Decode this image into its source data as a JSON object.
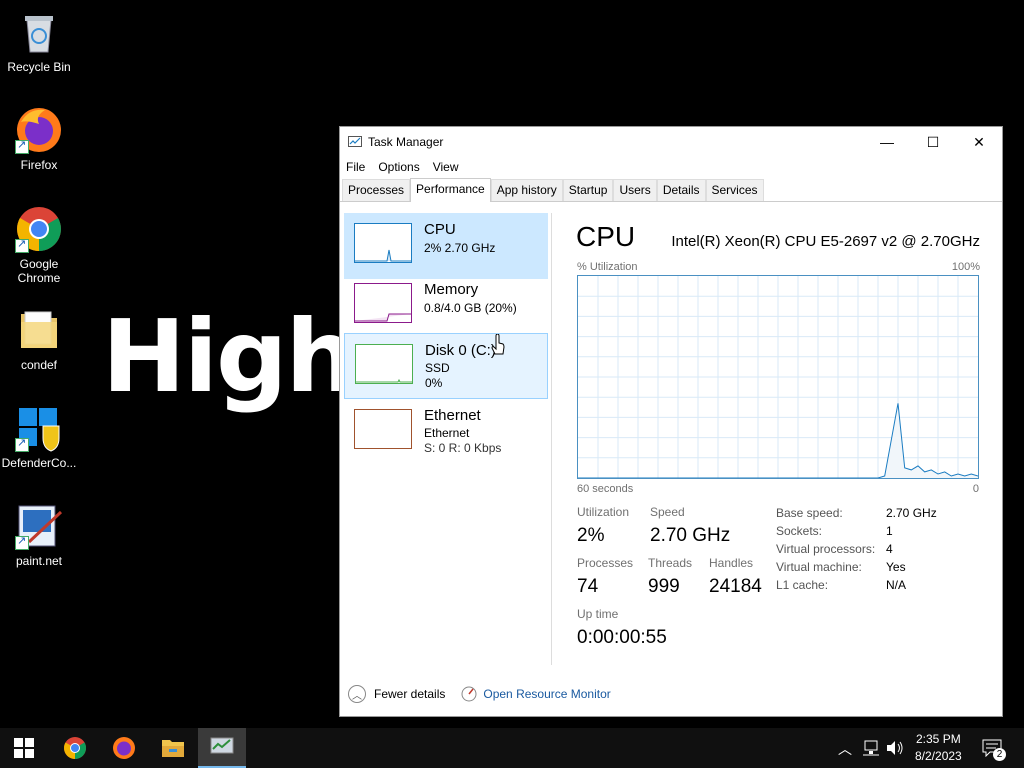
{
  "desktop": {
    "icons": [
      {
        "label": "Recycle Bin",
        "icon": "recycle-bin-icon"
      },
      {
        "label": "Firefox",
        "icon": "firefox-icon"
      },
      {
        "label": "Google Chrome",
        "icon": "chrome-icon"
      },
      {
        "label": "condef",
        "icon": "folder-icon"
      },
      {
        "label": "DefenderCo...",
        "icon": "defender-icon"
      },
      {
        "label": "paint.net",
        "icon": "paintnet-icon"
      }
    ],
    "overlay_text": "High"
  },
  "window": {
    "title": "Task Manager",
    "controls": {
      "minimize": "—",
      "maximize": "☐",
      "close": "✕"
    },
    "menu": [
      "File",
      "Options",
      "View"
    ],
    "tabs": [
      "Processes",
      "Performance",
      "App history",
      "Startup",
      "Users",
      "Details",
      "Services"
    ],
    "active_tab": "Performance"
  },
  "resources": [
    {
      "name": "CPU",
      "line1": "2%  2.70 GHz",
      "line2": "",
      "color": "#1a7cc2"
    },
    {
      "name": "Memory",
      "line1": "0.8/4.0 GB (20%)",
      "line2": "",
      "color": "#8b1a8b"
    },
    {
      "name": "Disk 0 (C:)",
      "line1": "SSD",
      "line2": "0%",
      "color": "#4caf50"
    },
    {
      "name": "Ethernet",
      "line1": "Ethernet",
      "line2": "S: 0  R: 0 Kbps",
      "color": "#a0522d"
    }
  ],
  "detail": {
    "title": "CPU",
    "model": "Intel(R) Xeon(R) CPU E5-2697 v2 @ 2.70GHz",
    "y_label": "% Utilization",
    "y_max_label": "100%",
    "x_left_label": "60 seconds",
    "x_right_label": "0",
    "stats": {
      "utilization_label": "Utilization",
      "utilization": "2%",
      "speed_label": "Speed",
      "speed": "2.70 GHz",
      "processes_label": "Processes",
      "processes": "74",
      "threads_label": "Threads",
      "threads": "999",
      "handles_label": "Handles",
      "handles": "24184",
      "uptime_label": "Up time",
      "uptime": "0:00:00:55"
    },
    "specs": [
      {
        "k": "Base speed:",
        "v": "2.70 GHz"
      },
      {
        "k": "Sockets:",
        "v": "1"
      },
      {
        "k": "Virtual processors:",
        "v": "4"
      },
      {
        "k": "Virtual machine:",
        "v": "Yes"
      },
      {
        "k": "L1 cache:",
        "v": "N/A"
      }
    ]
  },
  "chart_data": {
    "type": "area",
    "x": [
      60,
      57,
      54,
      51,
      48,
      45,
      42,
      39,
      36,
      33,
      30,
      27,
      24,
      21,
      18,
      15,
      14,
      12,
      11,
      10,
      9,
      8,
      7,
      6,
      5,
      4,
      3,
      2,
      1,
      0
    ],
    "y": [
      0,
      0,
      0,
      0,
      0,
      0,
      0,
      0,
      0,
      0,
      0,
      0,
      0,
      0,
      0,
      0,
      1,
      37,
      5,
      4,
      6,
      3,
      4,
      2,
      3,
      1,
      2,
      1,
      2,
      1
    ],
    "ylim": [
      0,
      100
    ],
    "color": "#1a7cc2"
  },
  "footer": {
    "fewer_details": "Fewer details",
    "resource_monitor": "Open Resource Monitor"
  },
  "taskbar": {
    "apps": [
      "start-icon",
      "chrome-icon",
      "firefox-icon",
      "file-explorer-icon",
      "task-manager-icon"
    ],
    "time": "2:35 PM",
    "date": "8/2/2023",
    "notifications": "2"
  }
}
